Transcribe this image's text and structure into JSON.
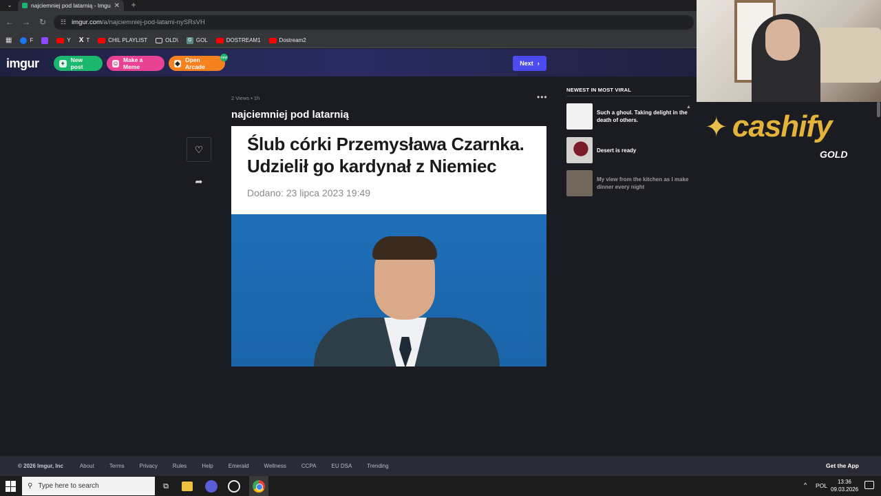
{
  "browser": {
    "tab_title": "najciemniej pod latarnią - Imgur",
    "url_host": "imgur.com",
    "url_path": "/a/najciemniej-pod-latami-nySRsVH",
    "bookmarks": [
      {
        "label": "F",
        "icon": "facebook-icon"
      },
      {
        "label": "",
        "icon": "twitch-icon"
      },
      {
        "label": "Y",
        "icon": "youtube-icon"
      },
      {
        "label": "T",
        "icon": "x-icon"
      },
      {
        "label": "CHIL PLAYLIST",
        "icon": "youtube-icon"
      },
      {
        "label": "OLD\\",
        "icon": "folder-icon"
      },
      {
        "label": "GOL",
        "icon": "g-icon"
      },
      {
        "label": "DOSTREAM1",
        "icon": "youtube-icon"
      },
      {
        "label": "Dostream2",
        "icon": "youtube-icon"
      }
    ]
  },
  "header": {
    "logo": "imgur",
    "new_post": "New post",
    "make_meme": "Make a Meme",
    "open_arcade": "Open Arcade",
    "arcade_badge": "new",
    "next": "Next"
  },
  "post": {
    "meta": "2 Views • 1h",
    "title": "najciemniej pod latarnią",
    "image_headline": "Ślub córki Przemysława Czarnka. Udzielił go kardynał z Niemiec",
    "image_date": "Dodano: 23 lipca 2023 19:49"
  },
  "sidebar": {
    "title": "NEWEST IN MOST VIRAL",
    "items": [
      {
        "text": "Such a ghoul. Taking delight in the death of others."
      },
      {
        "text": "Desert  is ready"
      },
      {
        "text": "My view from the kitchen as I make dinner every night"
      }
    ]
  },
  "overlay": {
    "brand": "cashify",
    "brand_sub": "GOLD"
  },
  "footer": {
    "copyright": "© 2026 Imgur, Inc",
    "links": [
      "About",
      "Terms",
      "Privacy",
      "Rules",
      "Help",
      "Emerald",
      "Wellness",
      "CCPA",
      "EU DSA",
      "Trending"
    ],
    "get_app": "Get the App"
  },
  "taskbar": {
    "search_placeholder": "Type here to search",
    "lang": "POL",
    "time": "13:36",
    "date": "09.03.2026"
  },
  "colors": {
    "new_post": "#1bb76e",
    "make_meme": "#e84393",
    "open_arcade": "#f5821f",
    "next": "#4b4bf0",
    "brand_gold": "#e3b33a"
  }
}
